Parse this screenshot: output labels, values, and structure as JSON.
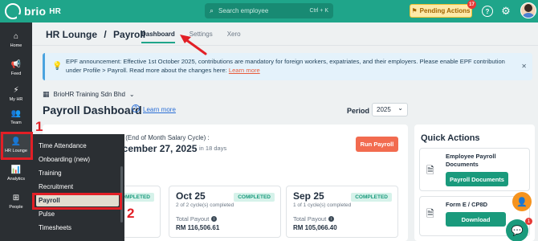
{
  "topbar": {
    "brand": "brio",
    "brand_suffix": "HR",
    "search_placeholder": "Search employee",
    "search_shortcut": "Ctrl + K",
    "pending_label": "Pending Actions",
    "pending_count": "17",
    "icons": [
      "help-icon",
      "gear-icon"
    ]
  },
  "sidebar": {
    "items": [
      {
        "label": "Home",
        "icon": "home-icon"
      },
      {
        "label": "Feed",
        "icon": "megaphone-icon"
      },
      {
        "label": "My HR",
        "icon": "bolt-icon"
      },
      {
        "label": "Team",
        "icon": "team-icon"
      },
      {
        "label": "HR Lounge",
        "icon": "user-gear-icon"
      },
      {
        "label": "Analytics",
        "icon": "chart-icon"
      },
      {
        "label": "People",
        "icon": "org-icon"
      }
    ]
  },
  "submenu": {
    "items": [
      "Time Attendance",
      "Onboarding (new)",
      "Training",
      "Recruitment",
      "Payroll",
      "Pulse",
      "Timesheets"
    ],
    "selected": "Payroll"
  },
  "header": {
    "breadcrumb_parent": "HR Lounge",
    "breadcrumb_sep": "/",
    "breadcrumb_current": "Payroll",
    "tabs": [
      "Dashboard",
      "Settings",
      "Xero"
    ],
    "active_tab": "Dashboard"
  },
  "announcement": {
    "text": "EPF announcement: Effective 1st October 2025, contributions are mandatory for foreign workers, expatriates, and their employers. Please enable EPF contribution under Profile > Payroll. Read more about the changes here:",
    "link": "Learn more"
  },
  "company": "BrioHR Training Sdn Bhd",
  "dashboard": {
    "title": "Payroll Dashboard",
    "learn_more": "Learn more",
    "period_label": "Period",
    "period_value": "2025",
    "salary_label": "y (End of Month Salary Cycle) :",
    "salary_date": "ecember 27, 2025",
    "salary_days": "in 18 days",
    "run_payroll": "Run Payroll",
    "cycles": [
      {
        "month": "",
        "status": "COMPLETED",
        "sub": "",
        "total_label": "",
        "amount": ""
      },
      {
        "month": "Oct 25",
        "status": "COMPLETED",
        "sub": "2 of 2 cycle(s) completed",
        "total_label": "Total Payout",
        "amount": "RM 116,506.61"
      },
      {
        "month": "Sep 25",
        "status": "COMPLETED",
        "sub": "1 of 1 cycle(s) completed",
        "total_label": "Total Payout",
        "amount": "RM 105,066.40"
      }
    ]
  },
  "quick_actions": {
    "title": "Quick Actions",
    "items": [
      {
        "label": "Employee Payroll Documents",
        "button": "Payroll Documents"
      },
      {
        "label": "Form E / CP8D",
        "button": "Download"
      }
    ]
  },
  "annotations": {
    "step1": "1",
    "step2": "2",
    "color": "#e21f26"
  },
  "colors": {
    "brand": "#1fa58a",
    "sidebar": "#2b2f33",
    "run_payroll": "#f26b4f",
    "completed": "#1a9a7c"
  }
}
